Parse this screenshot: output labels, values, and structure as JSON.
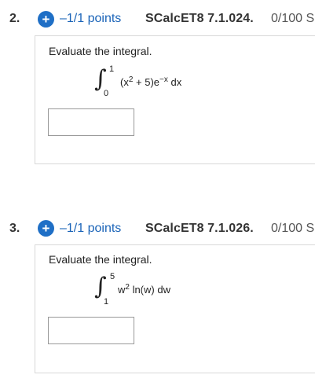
{
  "questions": [
    {
      "number": "2.",
      "points": "–1/1 points",
      "code": "SCalcET8 7.1.024.",
      "score": "0/100 S",
      "prompt": "Evaluate the integral.",
      "upper": "1",
      "lower": "0",
      "integrand": {
        "a": "(x",
        "exp": "2",
        "b": " + 5)e",
        "exp2": "−x",
        "c": " dx"
      },
      "answer_value": ""
    },
    {
      "number": "3.",
      "points": "–1/1 points",
      "code": "SCalcET8 7.1.026.",
      "score": "0/100 S",
      "prompt": "Evaluate the integral.",
      "upper": "5",
      "lower": "1",
      "integrand": {
        "a": "w",
        "exp": "2",
        "b": " ln(w) dw"
      },
      "answer_value": ""
    }
  ],
  "icons": {
    "plus": "plus-icon"
  },
  "colors": {
    "accent": "#1f6fc6",
    "points_text": "#1b64b8"
  }
}
